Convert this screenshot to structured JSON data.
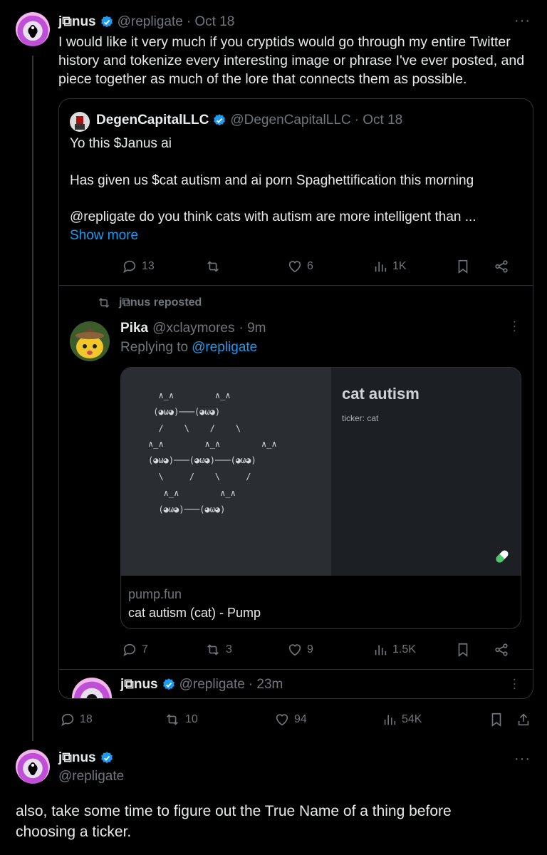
{
  "main_tweet": {
    "name": "j⧉nus",
    "handle": "@repligate",
    "date": "· Oct 18",
    "text": "I would like it very much if you cryptids would go through my entire Twitter history and tokenize every interesting image or phrase I've ever posted, and piece together as much of the lore that connects them as possible.",
    "more": "···",
    "stats": {
      "replies": "18",
      "retweets": "10",
      "likes": "94",
      "views": "54K"
    }
  },
  "quote": {
    "name": "DegenCapitalLLC",
    "handle": "@DegenCapitalLLC",
    "date": "· Oct 18",
    "line1": "Yo this $Janus ai",
    "line2": "Has given us $cat autism and ai porn Spaghettification this morning",
    "line3": "@repligate do you think cats with autism are more intelligent than ...",
    "show_more": "Show more",
    "stats": {
      "replies": "13",
      "likes": "6",
      "views": "1K"
    }
  },
  "repost": {
    "label": "j⧉nus reposted",
    "name": "Pika",
    "handle": "@xclaymores",
    "date": "· 9m",
    "replying_prefix": "Replying to",
    "replying_to": "@repligate",
    "card": {
      "title": "cat autism",
      "ticker": "ticker: cat",
      "ascii_art": "  ∧_∧        ∧_∧\n (◕ω◕)───(◕ω◕)\n  /    \\    /    \\\n∧_∧        ∧_∧        ∧_∧\n(◕ω◕)───(◕ω◕)───(◕ω◕)\n  \\     /    \\     /\n   ∧_∧        ∧_∧\n  (◕ω◕)───(◕ω◕)",
      "domain": "pump.fun",
      "link_title": "cat autism (cat) - Pump"
    },
    "stats": {
      "replies": "7",
      "retweets": "3",
      "likes": "9",
      "views": "1.5K"
    }
  },
  "nested": {
    "name": "j⧉nus",
    "handle": "@repligate",
    "date": "· 23m"
  },
  "reply_tweet": {
    "name": "j⧉nus",
    "handle": "@repligate",
    "more": "···",
    "text": "also, take some time to figure out the True Name of a thing before choosing a ticker."
  },
  "colors": {
    "accent": "#1d9bf0",
    "muted": "#71767b",
    "text": "#e7e9ea",
    "border": "#2f3336"
  }
}
